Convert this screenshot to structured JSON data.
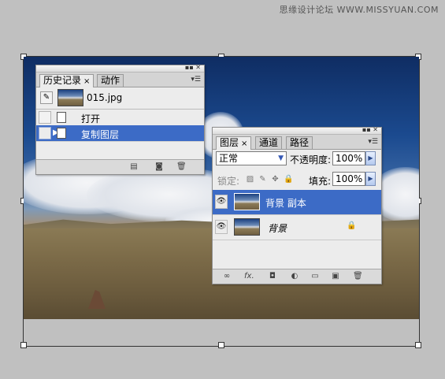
{
  "watermark": "思缘设计论坛 WWW.MISSYUAN.COM",
  "history_panel": {
    "tabs": [
      {
        "label": "历史记录",
        "close": "×"
      },
      {
        "label": "动作"
      }
    ],
    "snapshot": "015.jpg",
    "steps": [
      {
        "label": "打开",
        "selected": false
      },
      {
        "label": "复制图层",
        "selected": true
      }
    ],
    "footer_icons": [
      "new-document-icon",
      "camera-icon",
      "trash-icon"
    ]
  },
  "layers_panel": {
    "tabs": [
      {
        "label": "图层",
        "close": "×"
      },
      {
        "label": "通道"
      },
      {
        "label": "路径"
      }
    ],
    "blend_mode": "正常",
    "opacity_label": "不透明度:",
    "opacity_value": "100%",
    "lock_label": "锁定:",
    "fill_label": "填充:",
    "fill_value": "100%",
    "layers": [
      {
        "name": "背景 副本",
        "active": true,
        "locked": false
      },
      {
        "name": "背景",
        "active": false,
        "locked": true
      }
    ],
    "footer_icons": [
      "link-icon",
      "fx-icon",
      "mask-icon",
      "adjustment-icon",
      "folder-icon",
      "new-layer-icon",
      "trash-icon"
    ],
    "fx_label": "fx."
  },
  "colors": {
    "selection": "#3c6bc6",
    "panel_bg": "#ececec",
    "canvas_bg": "#c0c0c0"
  }
}
